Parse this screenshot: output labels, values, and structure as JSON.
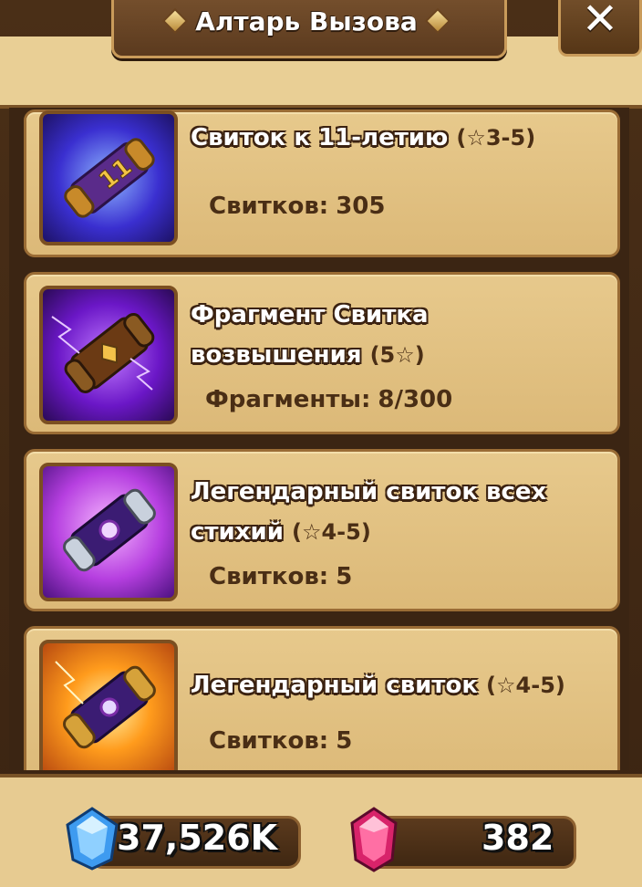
{
  "header": {
    "title": "Алтарь Вызова",
    "close_label": "✕"
  },
  "items": [
    {
      "title_line1": "Свиток к 11-летию",
      "title_line2": "",
      "grade": "(☆3-5)",
      "count_label": "Свитков:",
      "count_value": "305",
      "icon": "anniversary-scroll-icon"
    },
    {
      "title_line1": "Фрагмент Свитка",
      "title_line2": "возвышения",
      "grade": "(5☆)",
      "count_label": "Фрагменты:",
      "count_value": "8/300",
      "icon": "transcendence-scroll-fragment-icon"
    },
    {
      "title_line1": "Легендарный свиток всех",
      "title_line2": "стихий",
      "grade": "(☆4-5)",
      "count_label": "Свитков:",
      "count_value": "5",
      "icon": "legendary-all-attribute-scroll-icon"
    },
    {
      "title_line1": "Легендарный свиток",
      "title_line2": "",
      "grade": "(☆4-5)",
      "count_label": "Свитков:",
      "count_value": "5",
      "icon": "legendary-scroll-icon"
    }
  ],
  "resources": {
    "crystals": "37,526K",
    "gems": "382"
  },
  "colors": {
    "parchment": "#e7c98c",
    "frame": "#3b2513",
    "text_dark": "#4a2e15"
  }
}
